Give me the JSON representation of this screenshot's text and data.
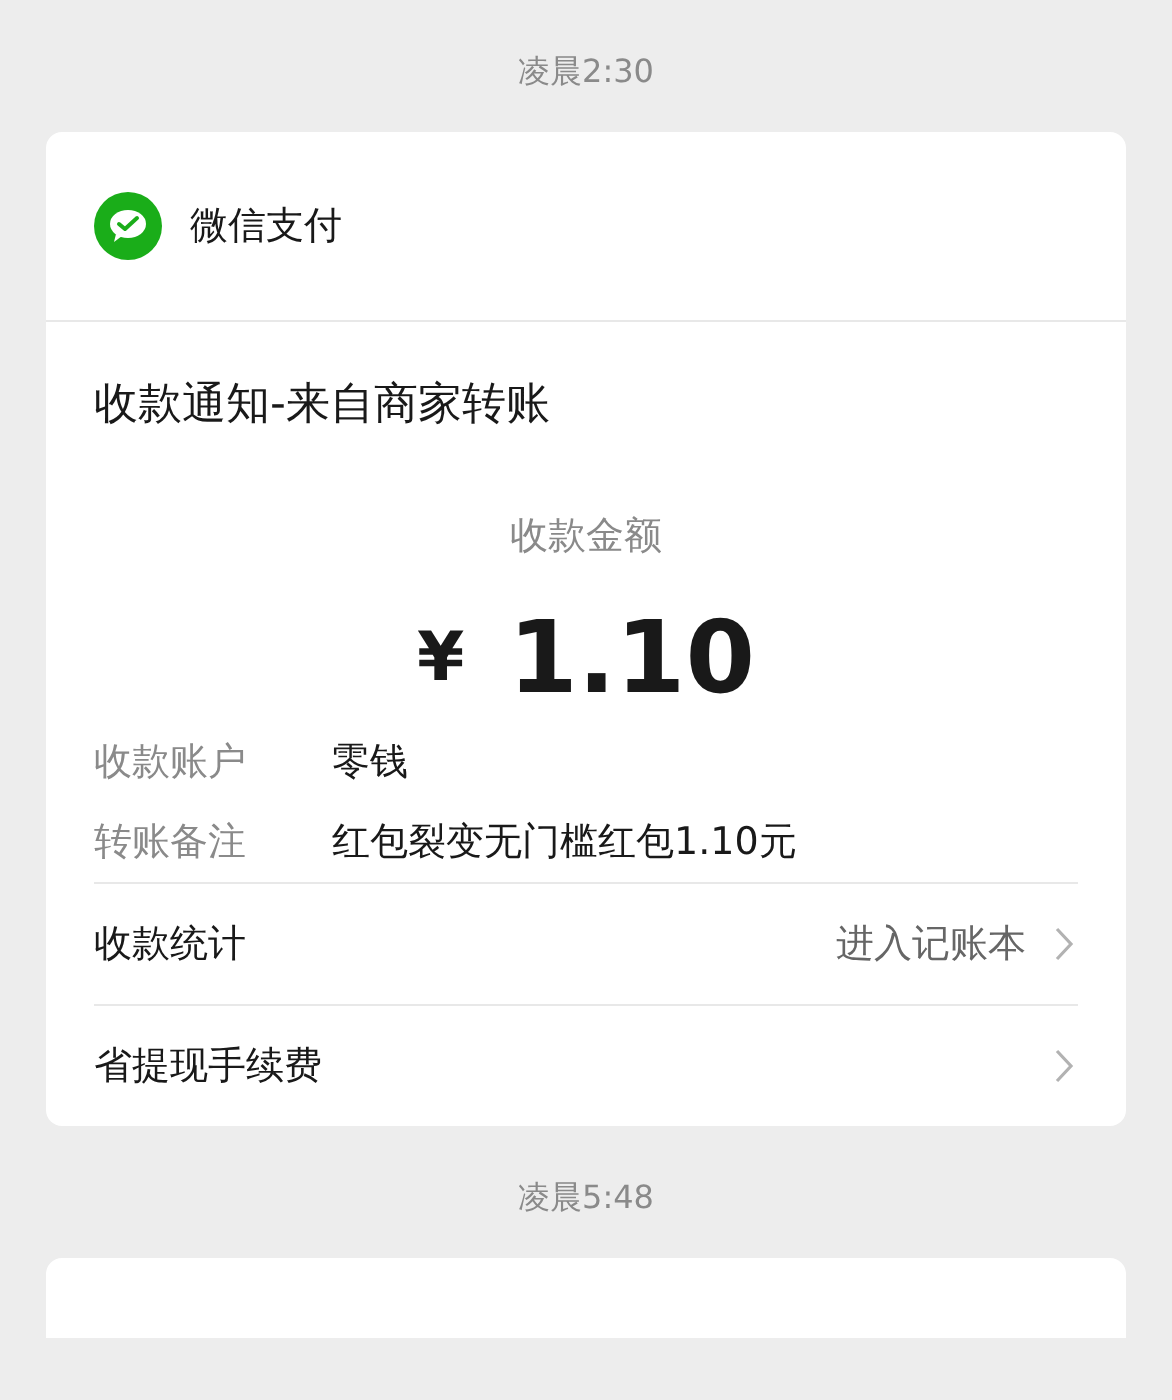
{
  "messages": [
    {
      "time": "凌晨2:30",
      "sender": "微信支付",
      "title": "收款通知-来自商家转账",
      "amount_label": "收款金额",
      "currency": "¥",
      "amount": "1.10",
      "details": [
        {
          "label": "收款账户",
          "value": "零钱"
        },
        {
          "label": "转账备注",
          "value": "红包裂变无门槛红包1.10元"
        }
      ],
      "links": [
        {
          "label": "收款统计",
          "hint": "进入记账本"
        },
        {
          "label": "省提现手续费"
        }
      ]
    },
    {
      "time": "凌晨5:48"
    }
  ]
}
